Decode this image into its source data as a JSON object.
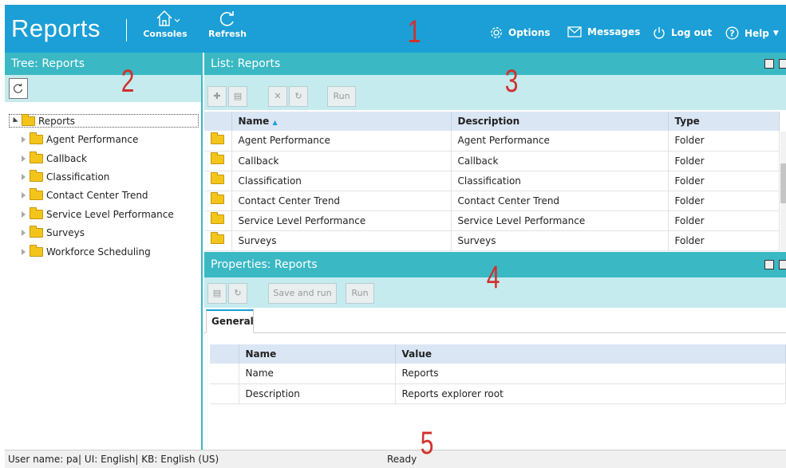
{
  "header": {
    "app_title": "Reports",
    "consoles_label": "Consoles",
    "refresh_label": "Refresh",
    "options_label": "Options",
    "messages_label": "Messages",
    "logout_label": "Log out",
    "help_label": "Help"
  },
  "tree": {
    "title": "Tree: Reports",
    "root": "Reports",
    "items": [
      {
        "label": "Agent Performance"
      },
      {
        "label": "Callback"
      },
      {
        "label": "Classification"
      },
      {
        "label": "Contact Center Trend"
      },
      {
        "label": "Service Level Performance"
      },
      {
        "label": "Surveys"
      },
      {
        "label": "Workforce Scheduling"
      }
    ]
  },
  "list": {
    "title": "List: Reports",
    "run_label": "Run",
    "columns": [
      "Name",
      "Description",
      "Type"
    ],
    "rows": [
      {
        "name": "Agent Performance",
        "description": "Agent Performance",
        "type": "Folder"
      },
      {
        "name": "Callback",
        "description": "Callback",
        "type": "Folder"
      },
      {
        "name": "Classification",
        "description": "Classification",
        "type": "Folder"
      },
      {
        "name": "Contact Center Trend",
        "description": "Contact Center Trend",
        "type": "Folder"
      },
      {
        "name": "Service Level Performance",
        "description": "Service Level Performance",
        "type": "Folder"
      },
      {
        "name": "Surveys",
        "description": "Surveys",
        "type": "Folder"
      }
    ]
  },
  "properties": {
    "title": "Properties: Reports",
    "save_and_run_label": "Save and run",
    "run_label": "Run",
    "tab_general": "General",
    "columns": [
      "Name",
      "Value"
    ],
    "rows": [
      {
        "name": "Name",
        "value": "Reports"
      },
      {
        "name": "Description",
        "value": "Reports explorer root"
      }
    ]
  },
  "status": {
    "user": "User name: pa",
    "ui": "UI: English",
    "kb": "KB: English (US)",
    "state": "Ready"
  },
  "annotations": [
    "1",
    "2",
    "3",
    "4",
    "5"
  ],
  "colors": {
    "header": "#1b9fd6",
    "panel": "#3ab8c4",
    "toolbar": "#c6ebef",
    "annotation": "#d0312d"
  }
}
